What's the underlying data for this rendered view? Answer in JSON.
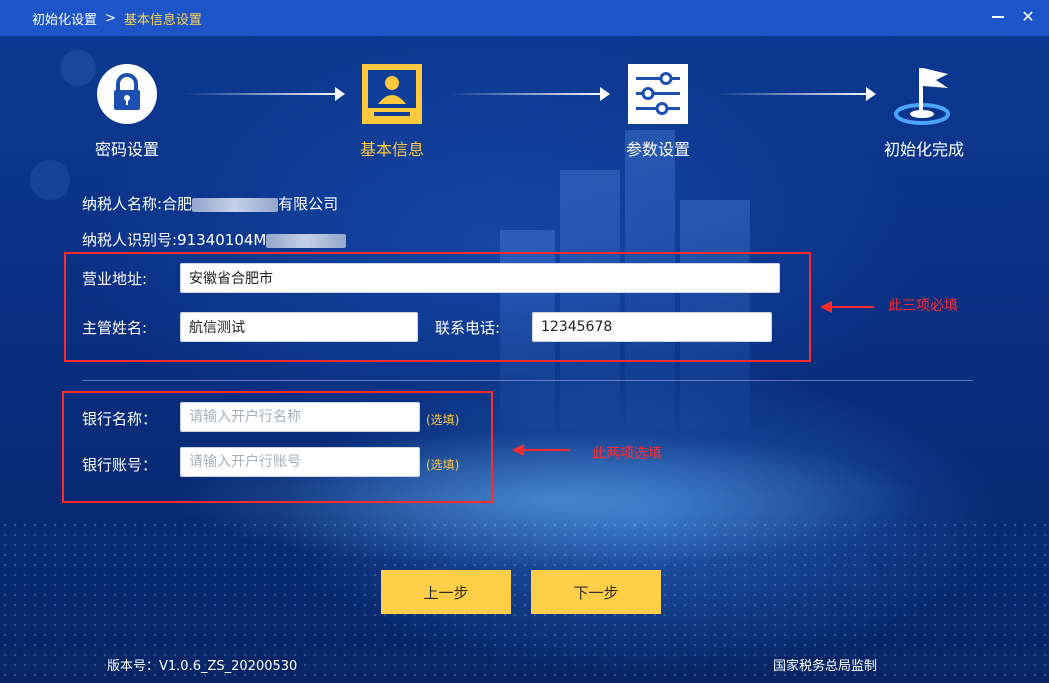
{
  "titlebar": {
    "crumb_root": "初始化设置",
    "separator": ">",
    "crumb_current": "基本信息设置",
    "minimize_label": "",
    "close_label": "✕"
  },
  "steps": [
    {
      "label": "密码设置",
      "icon": "lock-icon",
      "active": false
    },
    {
      "label": "基本信息",
      "icon": "user-card-icon",
      "active": true
    },
    {
      "label": "参数设置",
      "icon": "sliders-icon",
      "active": false
    },
    {
      "label": "初始化完成",
      "icon": "flag-icon",
      "active": false
    }
  ],
  "taxpayer": {
    "name_label": "纳税人名称:",
    "name_prefix": "合肥",
    "name_suffix": "有限公司",
    "id_label": "纳税人识别号:",
    "id_prefix": "91340104M"
  },
  "required": {
    "address_label": "营业地址:",
    "address_value": "安徽省合肥市",
    "manager_label": "主管姓名:",
    "manager_value": "航信测试",
    "phone_label": "联系电话:",
    "phone_value": "12345678",
    "note": "此三项必填"
  },
  "optional": {
    "bank_name_label": "银行名称：",
    "bank_name_placeholder": "请输入开户行名称",
    "bank_name_tag": "(选填)",
    "bank_account_label": "银行账号：",
    "bank_account_placeholder": "请输入开户行账号",
    "bank_account_tag": "(选填)",
    "note": "此两项选填"
  },
  "buttons": {
    "prev": "上一步",
    "next": "下一步"
  },
  "footer": {
    "version": "版本号：V1.0.6_ZS_20200530",
    "supervision": "国家税务总局监制"
  },
  "colors": {
    "accent": "#ffcf4a",
    "active_step": "#ffc83d",
    "annotation": "#ff2b2b",
    "titlebar": "#1d55c9"
  }
}
